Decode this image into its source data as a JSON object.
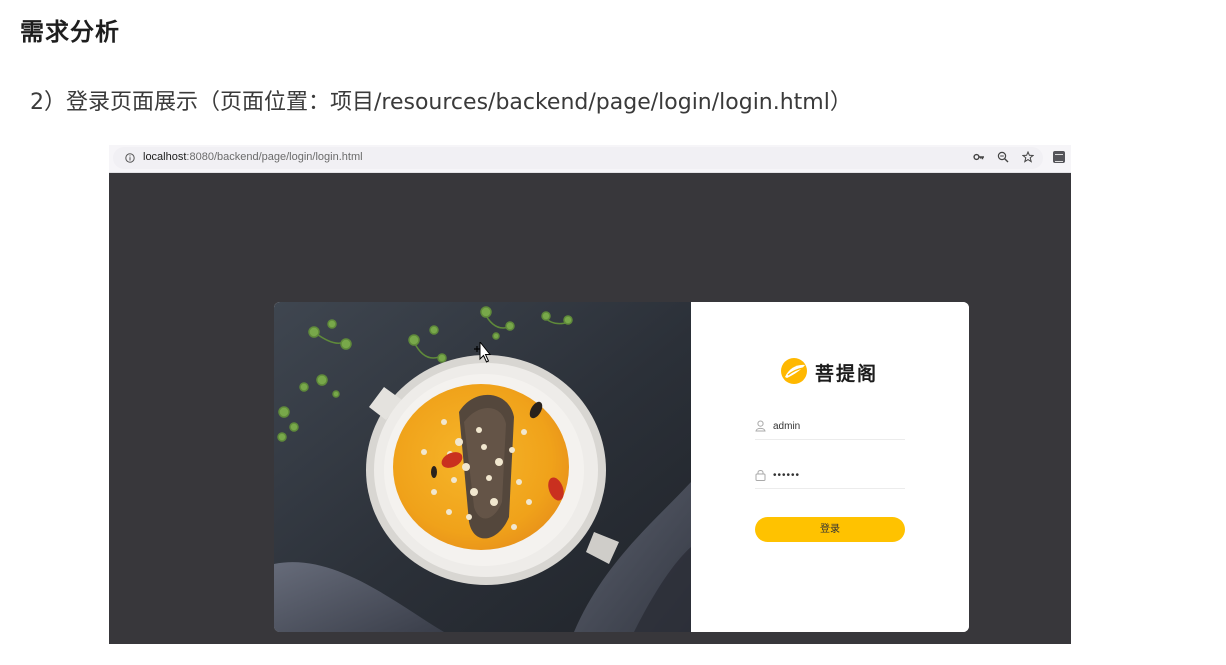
{
  "slide": {
    "title": "需求分析",
    "subtitle": "2）登录页面展示（页面位置：项目/resources/backend/page/login/login.html）"
  },
  "browser": {
    "url_host": "localhost",
    "url_path": ":8080/backend/page/login/login.html",
    "icons": [
      "info-icon",
      "key-icon",
      "zoom-icon",
      "bookmark-star-icon",
      "extension-icon"
    ]
  },
  "login": {
    "brand_name": "菩提阁",
    "username_value": "admin",
    "password_value": "••••••",
    "submit_label": "登录",
    "accent_color": "#ffc200"
  }
}
